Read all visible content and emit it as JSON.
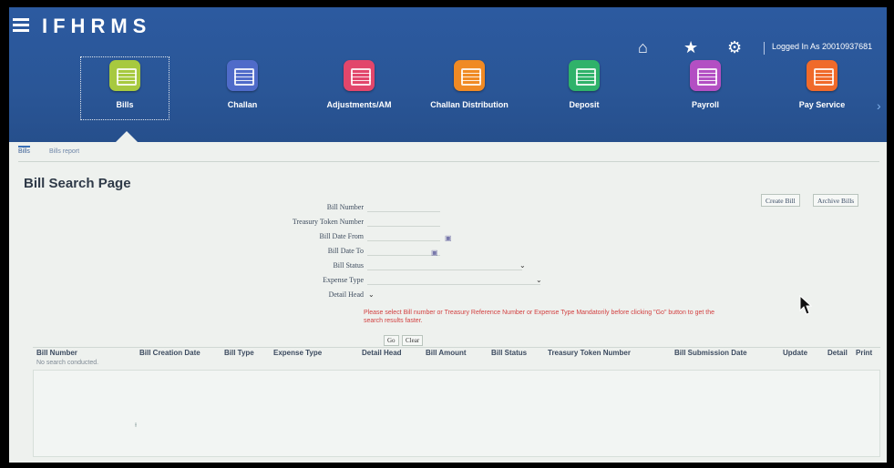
{
  "header": {
    "app_title": "IFHRMS",
    "logged_in_text": "Logged In As 20010937681",
    "icons": [
      "menu-icon",
      "home-icon",
      "star-icon",
      "gear-icon"
    ]
  },
  "modules": [
    {
      "label": "Bills",
      "color": "#a7c93f"
    },
    {
      "label": "Challan",
      "color": "#4f6bc9"
    },
    {
      "label": "Adjustments/AM",
      "color": "#e2466b"
    },
    {
      "label": "Challan Distribution",
      "color": "#f08a24"
    },
    {
      "label": "Deposit",
      "color": "#2fb26a"
    },
    {
      "label": "Payroll",
      "color": "#b34fc3"
    },
    {
      "label": "Pay Service",
      "color": "#f06a2a"
    }
  ],
  "tabs": [
    "Bills",
    "Bills report"
  ],
  "page": {
    "title": "Bill Search Page",
    "create_bill": "Create Bill",
    "archive_bills": "Archive Bills"
  },
  "form": {
    "labels": [
      "Bill Number",
      "Treasury Token Number",
      "Bill Date From",
      "Bill Date To",
      "Bill Status",
      "Expense Type",
      "Detail Head"
    ],
    "message": "Please select Bill number or Treasury Reference Number or Expense Type Mandatorily before clicking \"Go\" button to get the search results faster.",
    "go": "Go",
    "clear": "Clear"
  },
  "table": {
    "columns": [
      "Bill Number",
      "Bill Creation Date",
      "Bill Type",
      "Expense Type",
      "Detail Head",
      "Bill Amount",
      "Bill Status",
      "Treasury Token Number",
      "Bill Submission Date",
      "Update",
      "Detail",
      "Print"
    ],
    "empty_text": "No search conducted."
  }
}
